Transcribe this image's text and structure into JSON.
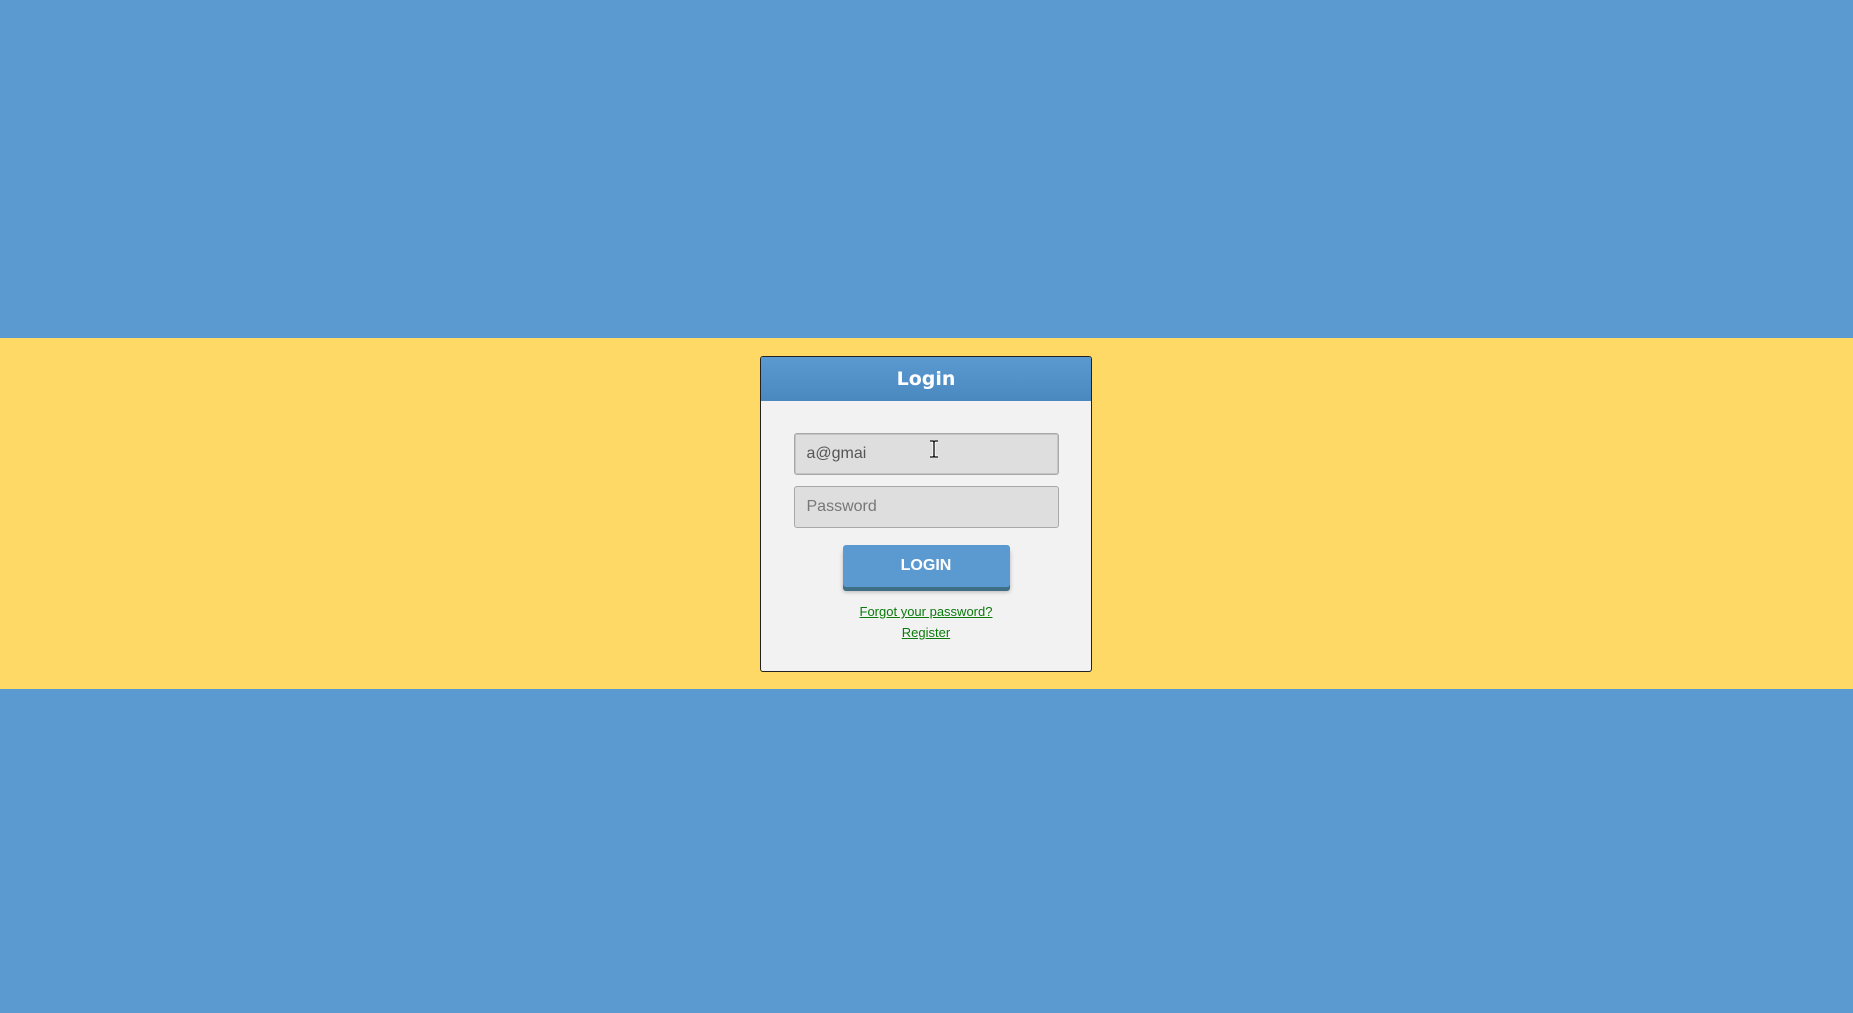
{
  "login_card": {
    "title": "Login",
    "email_value": "a@gmai",
    "password_placeholder": "Password",
    "login_button_label": "LOGIN",
    "forgot_password_link": "Forgot your password?",
    "register_link": "Register"
  },
  "colors": {
    "background_blue": "#5b9ad0",
    "band_yellow": "#ffd966",
    "card_bg": "#f2f2f2",
    "link_green": "#0a7a0a"
  },
  "icons": {
    "cursor": "text-cursor-icon"
  }
}
